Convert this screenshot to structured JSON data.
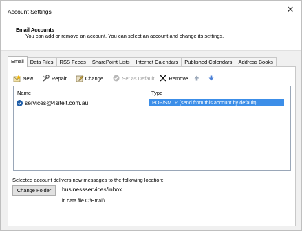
{
  "window": {
    "title": "Account Settings",
    "close_glyph": "✕"
  },
  "header": {
    "title": "Email Accounts",
    "description": "You can add or remove an account. You can select an account and change its settings."
  },
  "tabs": [
    {
      "label": "Email",
      "active": true
    },
    {
      "label": "Data Files"
    },
    {
      "label": "RSS Feeds"
    },
    {
      "label": "SharePoint Lists"
    },
    {
      "label": "Internet Calendars"
    },
    {
      "label": "Published Calendars"
    },
    {
      "label": "Address Books"
    }
  ],
  "toolbar": {
    "new_label": "New...",
    "repair_label": "Repair...",
    "change_label": "Change...",
    "default_label": "Set as Default",
    "remove_label": "Remove"
  },
  "accounts": {
    "col_name": "Name",
    "col_type": "Type",
    "rows": [
      {
        "name": "services@4siteit.com.au",
        "type": "POP/SMTP (send from this account by default)"
      }
    ]
  },
  "delivery": {
    "label": "Selected account delivers new messages to the following location:",
    "change_folder_label": "Change Folder",
    "location": "businessservices/inbox",
    "data_file": "in data file C:\\Email\\"
  },
  "colors": {
    "selection": "#3c8ee8",
    "check": "#1f5ea8",
    "remove_x": "#000000",
    "arrow": "#4a7fd6"
  }
}
